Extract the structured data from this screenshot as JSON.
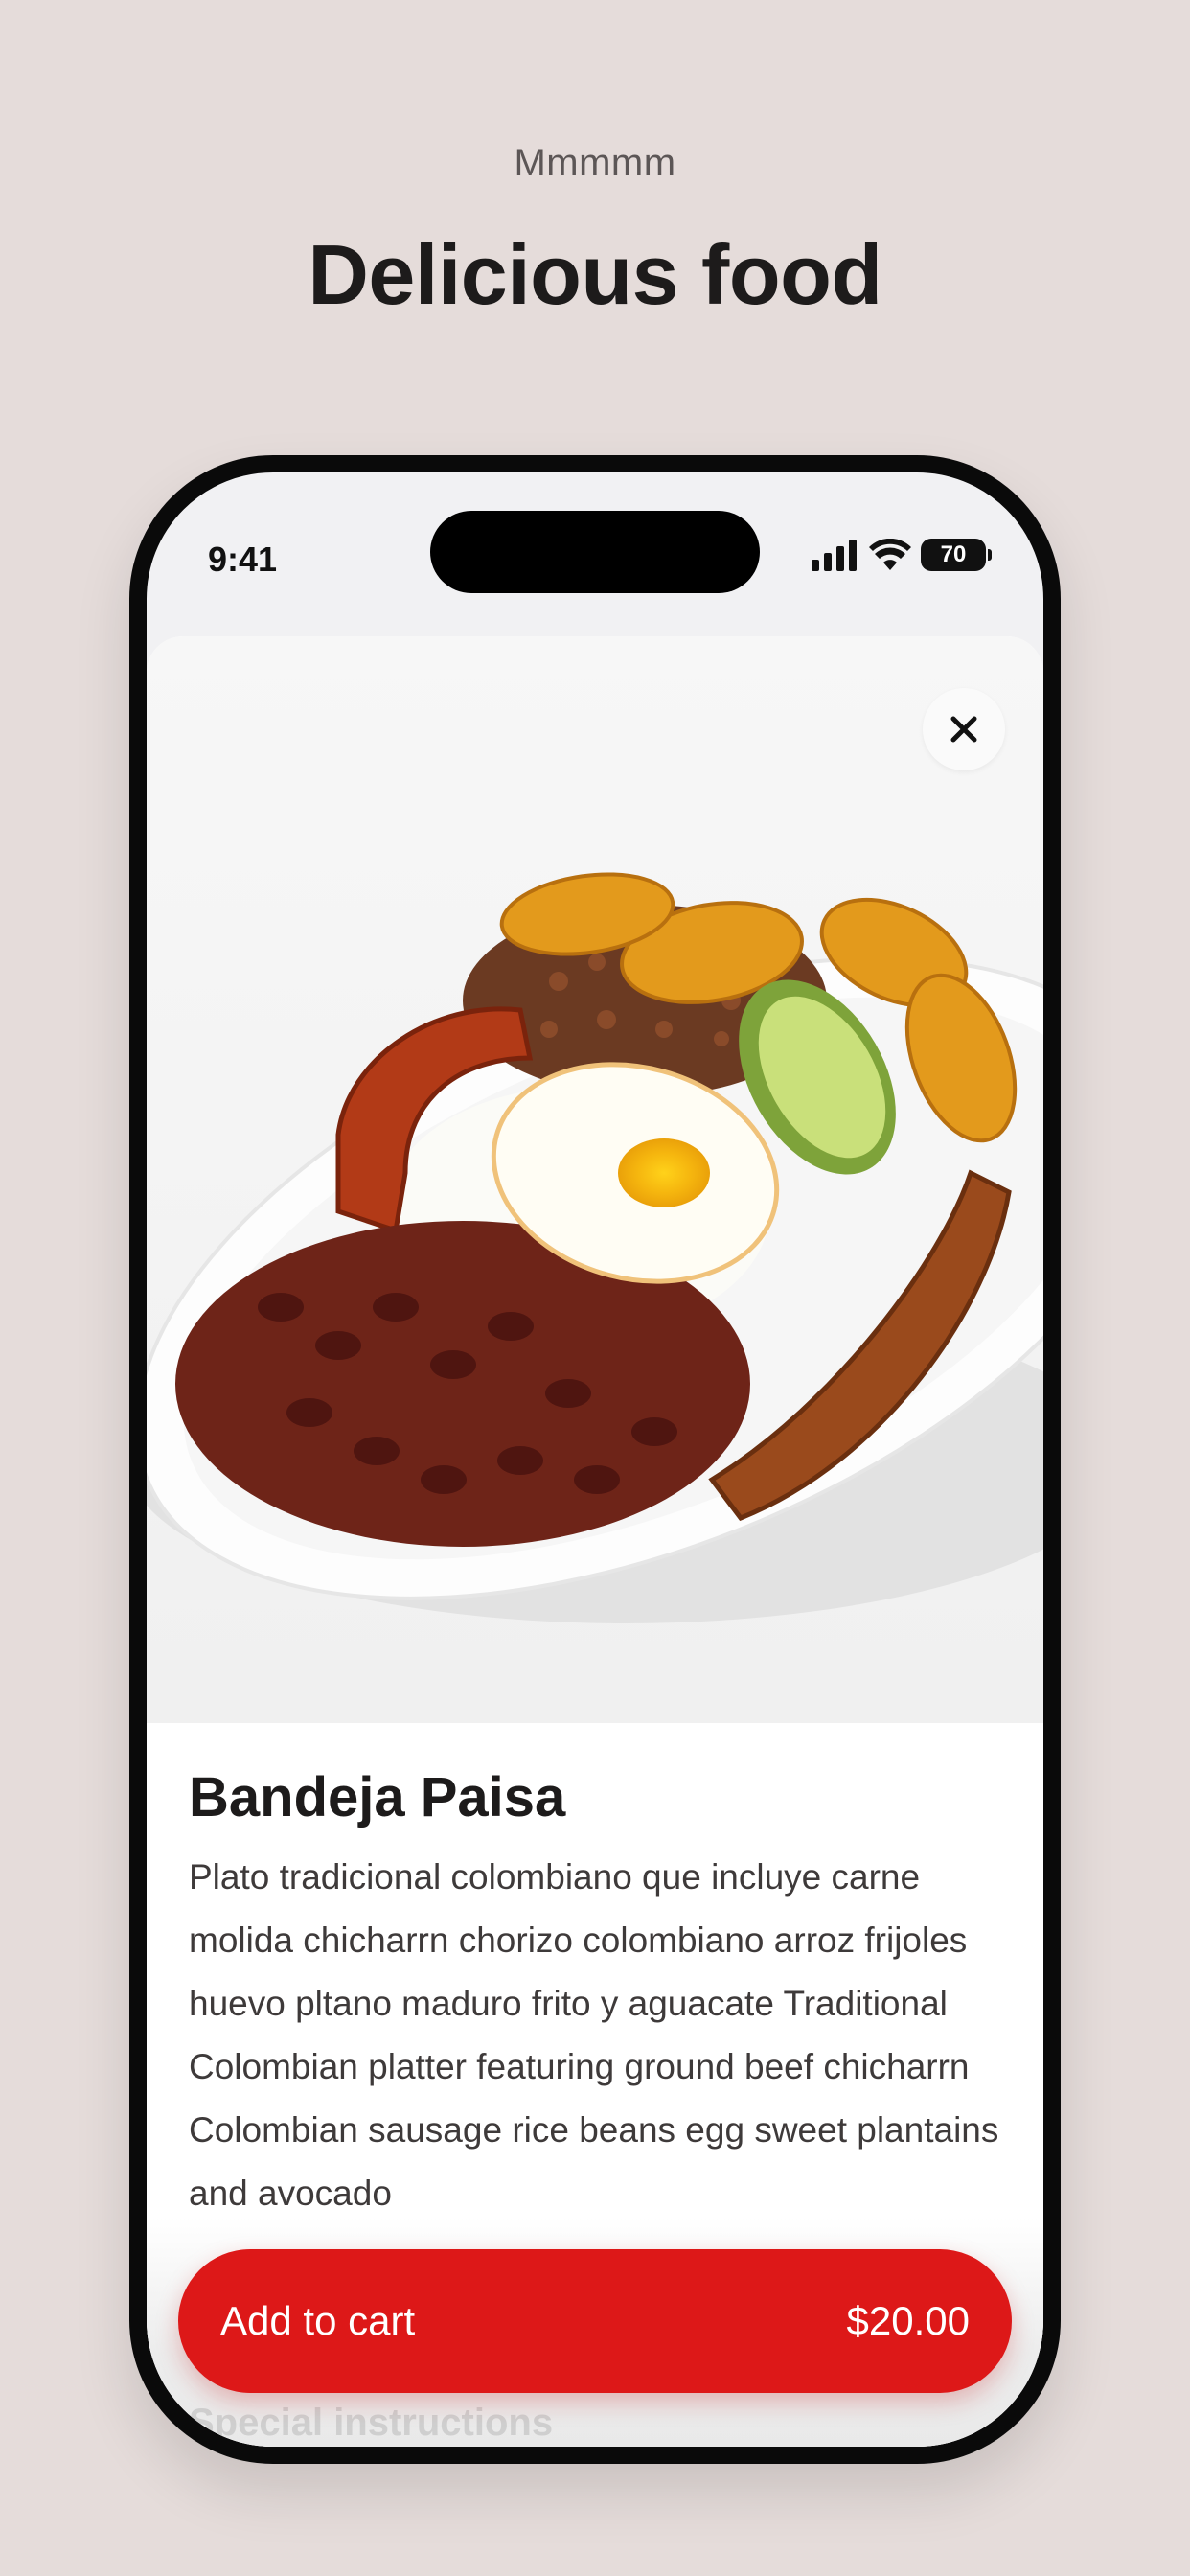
{
  "header": {
    "eyebrow": "Mmmmm",
    "title": "Delicious food"
  },
  "status_bar": {
    "time": "9:41",
    "battery": "70"
  },
  "product": {
    "name": "Bandeja Paisa",
    "description": "Plato tradicional colombiano que incluye carne molida chicharrn chorizo colombiano arroz frijoles huevo pltano maduro frito y aguacate Traditional Colombian platter featuring ground beef chicharrn Colombian sausage rice beans egg sweet plantains and avocado",
    "section_label": "Special instructions"
  },
  "cart": {
    "label": "Add to cart",
    "price": "$20.00"
  },
  "icons": {
    "close": "close-icon",
    "signal": "cellular-signal-icon",
    "wifi": "wifi-icon",
    "battery": "battery-icon"
  },
  "colors": {
    "background": "#e5dcda",
    "accent": "#dd1818",
    "text": "#1d1b1b"
  }
}
